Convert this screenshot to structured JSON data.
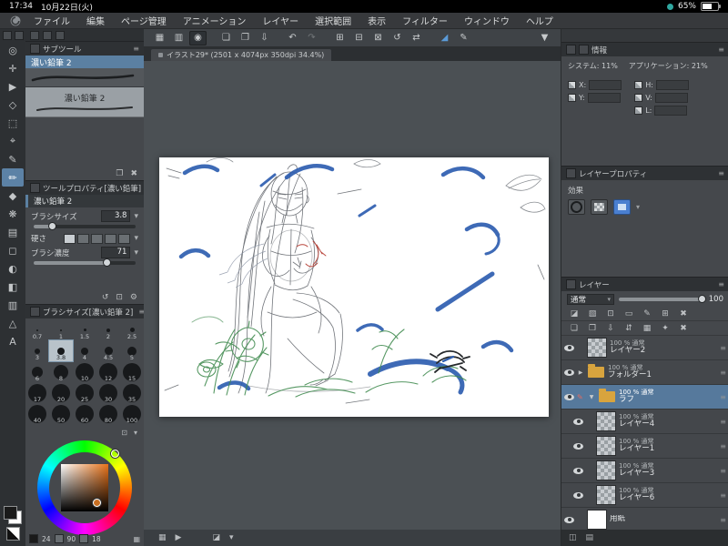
{
  "ui_icons": {
    "burger": "≡",
    "caret_down": "▾",
    "tri_right": "▶",
    "tri_down": "▼",
    "grid": "▦",
    "panels": "▥",
    "spiral": "◉",
    "new_file": "❏",
    "open_file": "❐",
    "save": "⇩",
    "undo": "↶",
    "redo": "↷",
    "snap_ruler": "⊞",
    "snap_special": "⊟",
    "snap_grid": "⊠",
    "rotate": "↺",
    "flip": "⇄",
    "selection_launcher": "◢",
    "pen": "✎",
    "gear": "⚙",
    "reset": "↺",
    "lock_small": "⊡",
    "duplicate": "❐",
    "delete": "✖",
    "navigator": "▦",
    "play": "▶",
    "compare": "◪",
    "panel_split": "◫",
    "list": "▤",
    "clip": "◪",
    "lock_alpha": "▧",
    "mask": "▭",
    "merge": "⇵",
    "apply": "✦",
    "new_layer": "❏",
    "new_folder": "❐",
    "transfer": "⇩",
    "make_mask": "▦"
  },
  "status_bar": {
    "time": "17:34",
    "date": "10月22日(火)",
    "battery": "65%"
  },
  "menu_bar": {
    "items": [
      "ファイル",
      "編集",
      "ページ管理",
      "アニメーション",
      "レイヤー",
      "選択範囲",
      "表示",
      "フィルター",
      "ウィンドウ",
      "ヘルプ"
    ]
  },
  "document_tab": {
    "title": "イラスト29* (2501 x 4074px 350dpi 34.4%)"
  },
  "tool_strip": {
    "tools": [
      {
        "name": "zoom-tool",
        "glyph": "◎"
      },
      {
        "name": "move-tool",
        "glyph": "✛"
      },
      {
        "name": "operation-tool",
        "glyph": "▶"
      },
      {
        "name": "layer-move-tool",
        "glyph": "◇"
      },
      {
        "name": "selection-tool",
        "glyph": "⬚"
      },
      {
        "name": "auto-select-tool",
        "glyph": "⌖"
      },
      {
        "name": "pen-tool",
        "glyph": "✎"
      },
      {
        "name": "pencil-tool",
        "glyph": "✏",
        "selected": true
      },
      {
        "name": "brush-tool",
        "glyph": "◆"
      },
      {
        "name": "airbrush-tool",
        "glyph": "❋"
      },
      {
        "name": "decoration-tool",
        "glyph": "▤"
      },
      {
        "name": "eraser-tool",
        "glyph": "◻"
      },
      {
        "name": "blend-tool",
        "glyph": "◐"
      },
      {
        "name": "fill-tool",
        "glyph": "◧"
      },
      {
        "name": "gradient-tool",
        "glyph": "▥"
      },
      {
        "name": "figure-tool",
        "glyph": "△"
      },
      {
        "name": "text-tool",
        "glyph": "A"
      }
    ],
    "main_color": "#1a1a1a",
    "sub_color": "#ffffff"
  },
  "subtool_panel": {
    "title": "サブツール",
    "selected_item": "濃い鉛筆 2",
    "items": [
      "濃い鉛筆 2",
      "濃い鉛筆 2"
    ]
  },
  "tool_property_panel": {
    "title": "ツールプロパティ[濃い鉛筆]",
    "subtool_label": "濃い鉛筆 2",
    "brush_size_label": "ブラシサイズ",
    "brush_size_value": "3.8",
    "hardness_label": "硬さ",
    "density_label": "ブラシ濃度",
    "density_value": "71"
  },
  "brush_size_panel": {
    "title": "ブラシサイズ[濃い鉛筆 2]",
    "selected": "3.8",
    "sizes": [
      "0.7",
      "1",
      "1.5",
      "2",
      "2.5",
      "3",
      "3.8",
      "4",
      "4.5",
      "5",
      "6",
      "8",
      "10",
      "12",
      "15",
      "17",
      "20",
      "25",
      "30",
      "35",
      "40",
      "50",
      "60",
      "80",
      "100"
    ]
  },
  "color_panel": {
    "selected_color": "#c96f22",
    "values": [
      "24",
      "90",
      "18"
    ]
  },
  "info_panel": {
    "title": "情報",
    "system_label": "システム:",
    "system_value": "11%",
    "app_label": "アプリケーション:",
    "app_value": "21%",
    "fields": [
      "X:",
      "Y:",
      "H:",
      "V:",
      "L:"
    ]
  },
  "layer_property_panel": {
    "title": "レイヤープロパティ",
    "effect_label": "効果"
  },
  "layer_panel": {
    "title": "レイヤー",
    "blend_mode": "通常",
    "opacity": "100",
    "layers": [
      {
        "meta": "100 % 通常",
        "name": "レイヤー2",
        "type": "layer"
      },
      {
        "meta": "100 % 通常",
        "name": "フォルダー1",
        "type": "folder-closed"
      },
      {
        "meta": "100 % 通常",
        "name": "ラフ",
        "type": "folder-open",
        "selected": true
      },
      {
        "meta": "100 % 通常",
        "name": "レイヤー4",
        "type": "layer"
      },
      {
        "meta": "100 % 通常",
        "name": "レイヤー1",
        "type": "layer"
      },
      {
        "meta": "100 % 通常",
        "name": "レイヤー3",
        "type": "layer"
      },
      {
        "meta": "100 % 通常",
        "name": "レイヤー6",
        "type": "layer"
      },
      {
        "meta": "",
        "name": "用紙",
        "type": "paper"
      }
    ]
  },
  "canvas": {
    "accent_blue": "#2e5eb0",
    "sketch_green": "#3f8a4e",
    "sketch_red": "#b8443a",
    "pencil_gray": "#63676d"
  }
}
